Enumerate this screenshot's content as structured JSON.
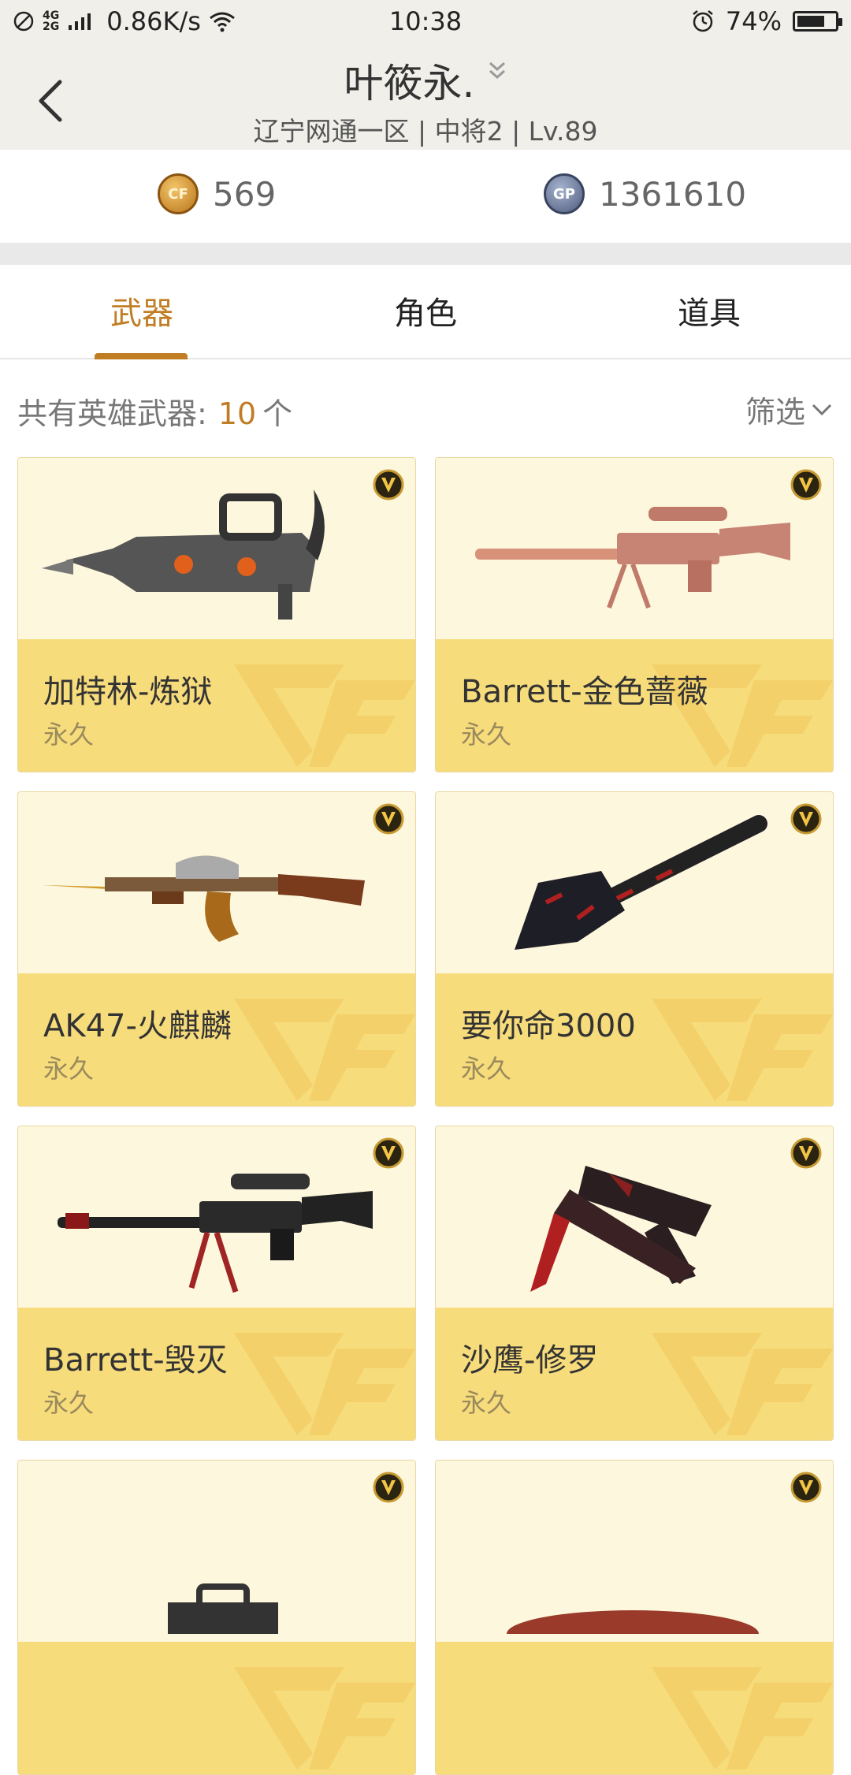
{
  "status_bar": {
    "network": "4G",
    "network2": "2G",
    "speed": "0.86K/s",
    "time": "10:38",
    "battery": "74%",
    "battery_level": 0.74
  },
  "header": {
    "back_icon": "chevron-left-icon",
    "player_name": "叶筱永.",
    "subtitle": "辽宁网通一区 | 中将2 | Lv.89"
  },
  "currency": {
    "cf_icon_text": "CF",
    "cf_amount": "569",
    "gp_icon_text": "GP",
    "gp_amount": "1361610"
  },
  "tabs": [
    {
      "label": "武器",
      "active": true
    },
    {
      "label": "角色",
      "active": false
    },
    {
      "label": "道具",
      "active": false
    }
  ],
  "summary": {
    "prefix": "共有英雄武器:",
    "count": "10",
    "suffix": "个",
    "filter_label": "筛选"
  },
  "colors": {
    "accent": "#c07d24",
    "card_top": "#fdf7dd",
    "card_bottom": "#f7dc7c"
  },
  "weapons": [
    {
      "name": "加特林-炼狱",
      "duration": "永久",
      "icon": "gatling-gun-icon"
    },
    {
      "name": "Barrett-金色蔷薇",
      "duration": "永久",
      "icon": "sniper-rifle-gold-icon"
    },
    {
      "name": "AK47-火麒麟",
      "duration": "永久",
      "icon": "ak47-icon"
    },
    {
      "name": "要你命3000",
      "duration": "永久",
      "icon": "shovel-icon"
    },
    {
      "name": "Barrett-毁灭",
      "duration": "永久",
      "icon": "sniper-rifle-dark-icon"
    },
    {
      "name": "沙鹰-修罗",
      "duration": "永久",
      "icon": "desert-eagle-icon"
    },
    {
      "name": "",
      "duration": "",
      "icon": "rifle-partial-icon"
    },
    {
      "name": "",
      "duration": "",
      "icon": "weapon-partial-icon"
    }
  ]
}
